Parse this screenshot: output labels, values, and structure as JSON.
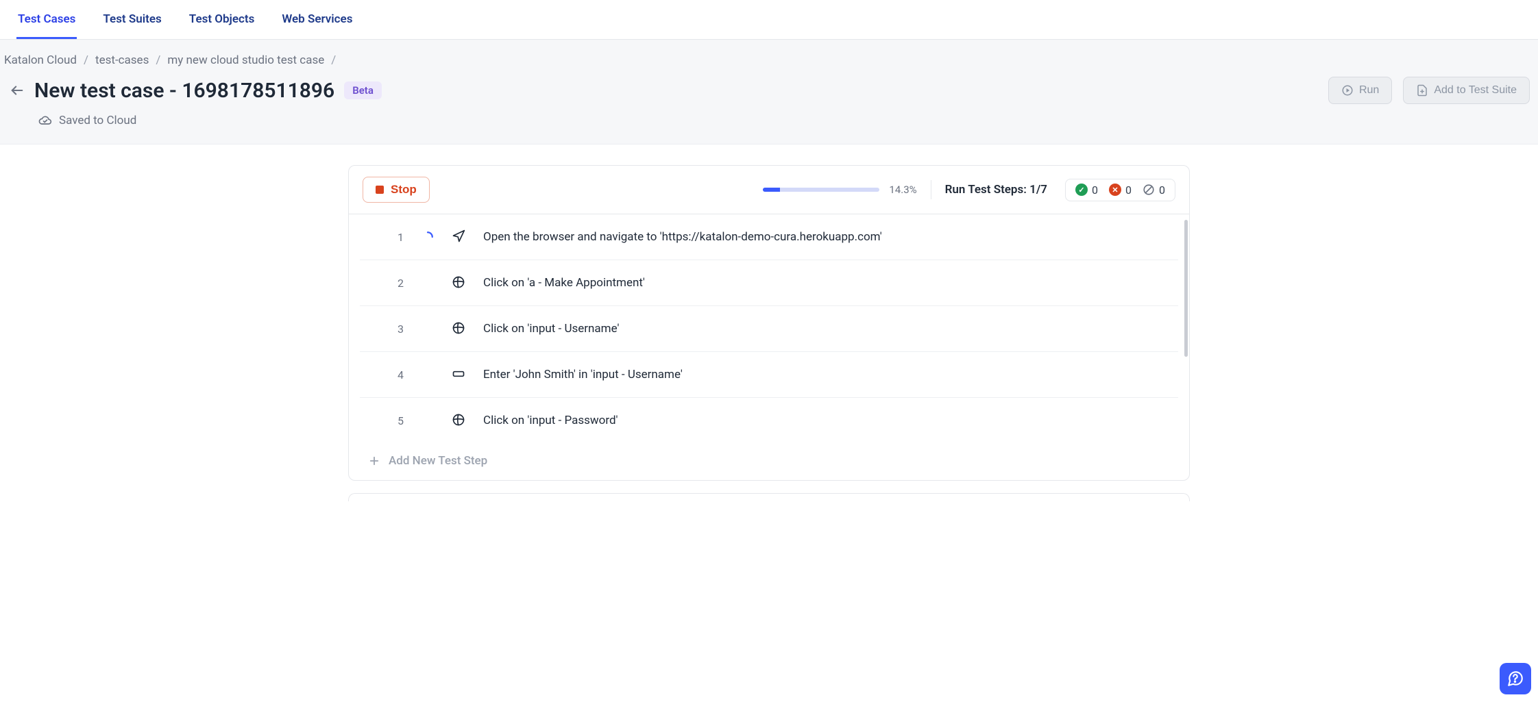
{
  "tabs": {
    "test_cases": "Test Cases",
    "test_suites": "Test Suites",
    "test_objects": "Test Objects",
    "web_services": "Web Services"
  },
  "breadcrumb": {
    "root": "Katalon Cloud",
    "section": "test-cases",
    "item": "my new cloud studio test case"
  },
  "page": {
    "title": "New test case - 1698178511896",
    "beta": "Beta",
    "saved": "Saved to Cloud"
  },
  "actions": {
    "run": "Run",
    "add_suite": "Add to Test Suite"
  },
  "runbar": {
    "stop": "Stop",
    "progress_pct": 14.3,
    "progress_label": "14.3%",
    "run_steps_label": "Run Test Steps:",
    "run_steps_value": "1/7",
    "passed": 0,
    "failed": 0,
    "skipped": 0
  },
  "steps": [
    {
      "num": "1",
      "icon": "navigate",
      "running": true,
      "text": "Open the browser and navigate to 'https://katalon-demo-cura.herokuapp.com'"
    },
    {
      "num": "2",
      "icon": "click",
      "running": false,
      "text": "Click on 'a - Make Appointment'"
    },
    {
      "num": "3",
      "icon": "click",
      "running": false,
      "text": "Click on 'input - Username'"
    },
    {
      "num": "4",
      "icon": "input",
      "running": false,
      "text": "Enter 'John Smith' in 'input - Username'"
    },
    {
      "num": "5",
      "icon": "click",
      "running": false,
      "text": "Click on 'input - Password'"
    }
  ],
  "add_step": "Add New Test Step"
}
